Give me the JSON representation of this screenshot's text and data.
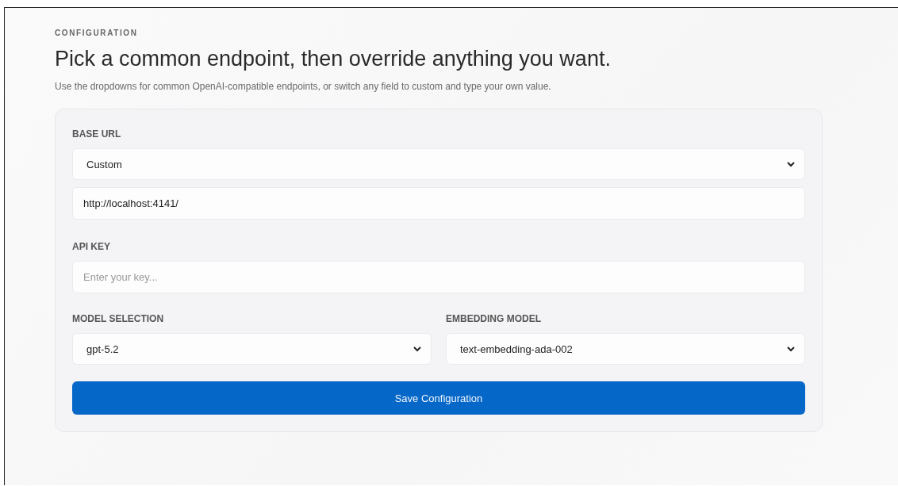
{
  "eyebrow": "CONFIGURATION",
  "heading": "Pick a common endpoint, then override anything you want.",
  "description": "Use the dropdowns for common OpenAI-compatible endpoints, or switch any field to custom and type your own value.",
  "form": {
    "base_url": {
      "label": "BASE URL",
      "dropdown": "Custom",
      "value": "http://localhost:4141/"
    },
    "api_key": {
      "label": "API KEY",
      "placeholder": "Enter your key..."
    },
    "model_selection": {
      "label": "MODEL SELECTION",
      "dropdown": "gpt-5.2"
    },
    "embedding_model": {
      "label": "EMBEDDING MODEL",
      "dropdown": "text-embedding-ada-002"
    },
    "save_button": "Save Configuration"
  }
}
